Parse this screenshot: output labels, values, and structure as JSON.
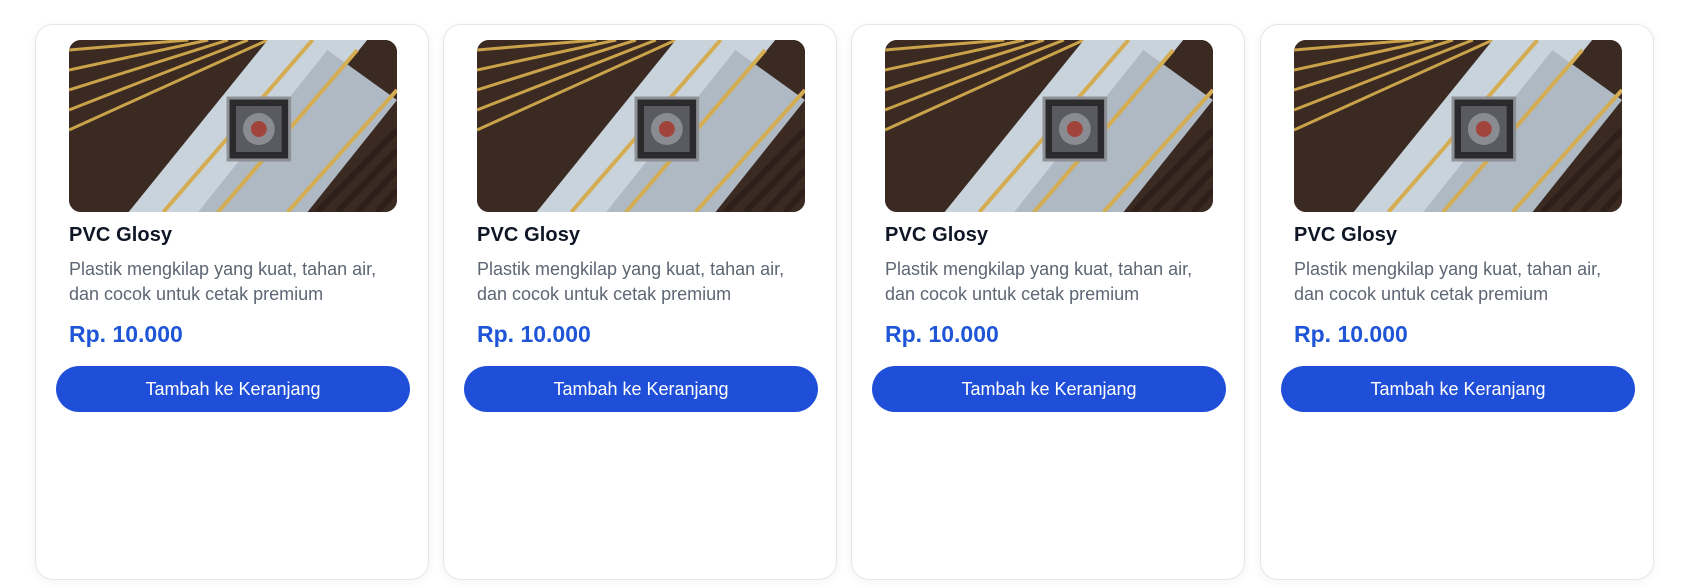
{
  "products": [
    {
      "image_icon": "pvc-ceiling-photo",
      "title": "PVC Glosy",
      "desc_line1": "Plastik mengkilap yang kuat, tahan air,",
      "desc_line2": "dan cocok untuk cetak premium",
      "price": "Rp. 10.000",
      "button_label": "Tambah ke Keranjang"
    },
    {
      "image_icon": "pvc-ceiling-photo",
      "title": "PVC Glosy",
      "desc_line1": "Plastik mengkilap yang kuat, tahan air,",
      "desc_line2": "dan cocok untuk cetak premium",
      "price": "Rp. 10.000",
      "button_label": "Tambah ke Keranjang"
    },
    {
      "image_icon": "pvc-ceiling-photo",
      "title": "PVC Glosy",
      "desc_line1": "Plastik mengkilap yang kuat, tahan air,",
      "desc_line2": "dan cocok untuk cetak premium",
      "price": "Rp. 10.000",
      "button_label": "Tambah ke Keranjang"
    },
    {
      "image_icon": "pvc-ceiling-photo",
      "title": "PVC Glosy",
      "desc_line1": "Plastik mengkilap yang kuat, tahan air,",
      "desc_line2": "dan cocok untuk cetak premium",
      "price": "Rp. 10.000",
      "button_label": "Tambah ke Keranjang"
    }
  ],
  "colors": {
    "accent": "#1f4fd8",
    "price": "#1f56d8",
    "title": "#0f1626",
    "description": "#5e6674",
    "card_border": "#e3e6ec"
  }
}
